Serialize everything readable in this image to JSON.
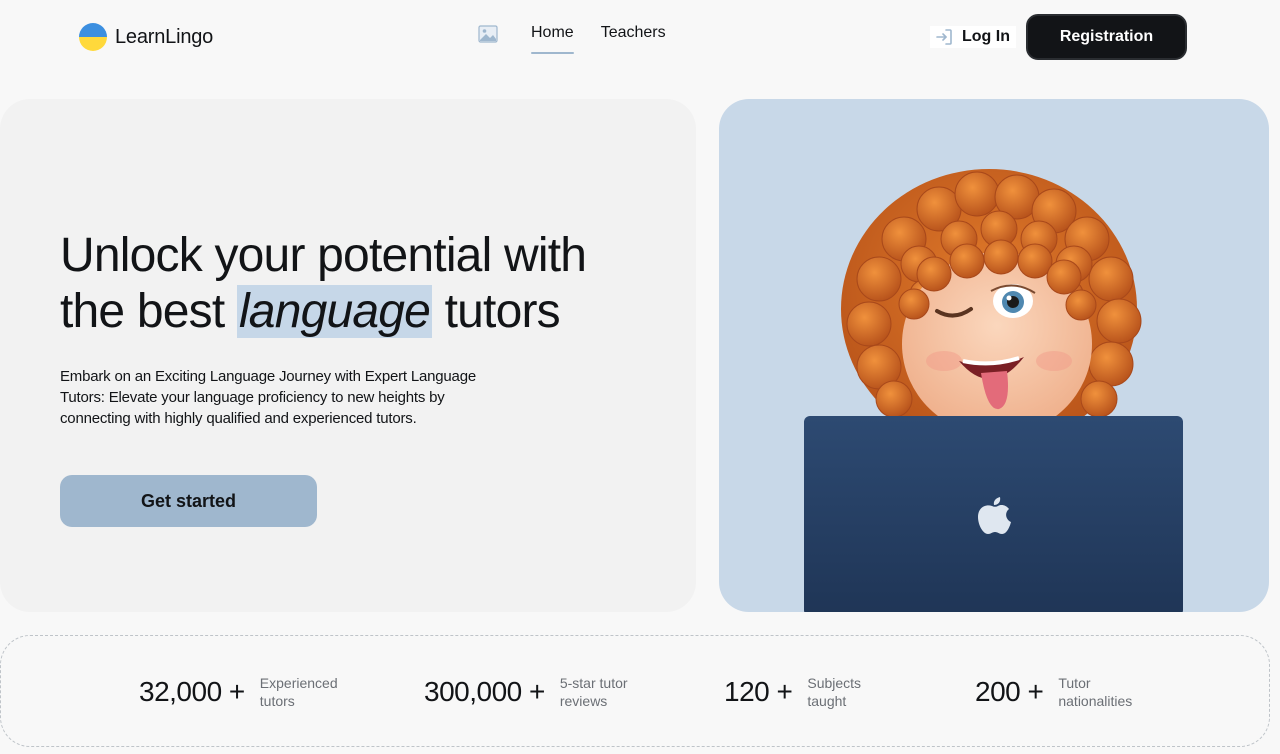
{
  "brand": {
    "name": "LearnLingo",
    "colors": {
      "flag_top": "#3c8fe0",
      "flag_bottom": "#ffd93b",
      "accent": "#9fb7ce",
      "highlight": "#c6d7e8"
    }
  },
  "nav": {
    "image_icon": "broken-image-icon",
    "items": [
      {
        "label": "Home",
        "active": true
      },
      {
        "label": "Teachers",
        "active": false
      }
    ]
  },
  "auth": {
    "login_icon": "login-icon",
    "login_label": "Log In",
    "register_label": "Registration"
  },
  "hero": {
    "title_part1": "Unlock your potential with the best ",
    "title_highlight": "language",
    "title_part2": " tutors",
    "description": "Embark on an Exciting Language Journey with Expert Language Tutors: Elevate your language proficiency to new heights by connecting with highly qualified and experienced tutors.",
    "cta_label": "Get started",
    "illustration": "memoji-with-laptop-illustration"
  },
  "stats": [
    {
      "value": "32,000 +",
      "label": "Experienced tutors"
    },
    {
      "value": "300,000 +",
      "label": "5-star tutor reviews"
    },
    {
      "value": "120 +",
      "label": "Subjects taught"
    },
    {
      "value": "200 +",
      "label": "Tutor nationalities"
    }
  ]
}
